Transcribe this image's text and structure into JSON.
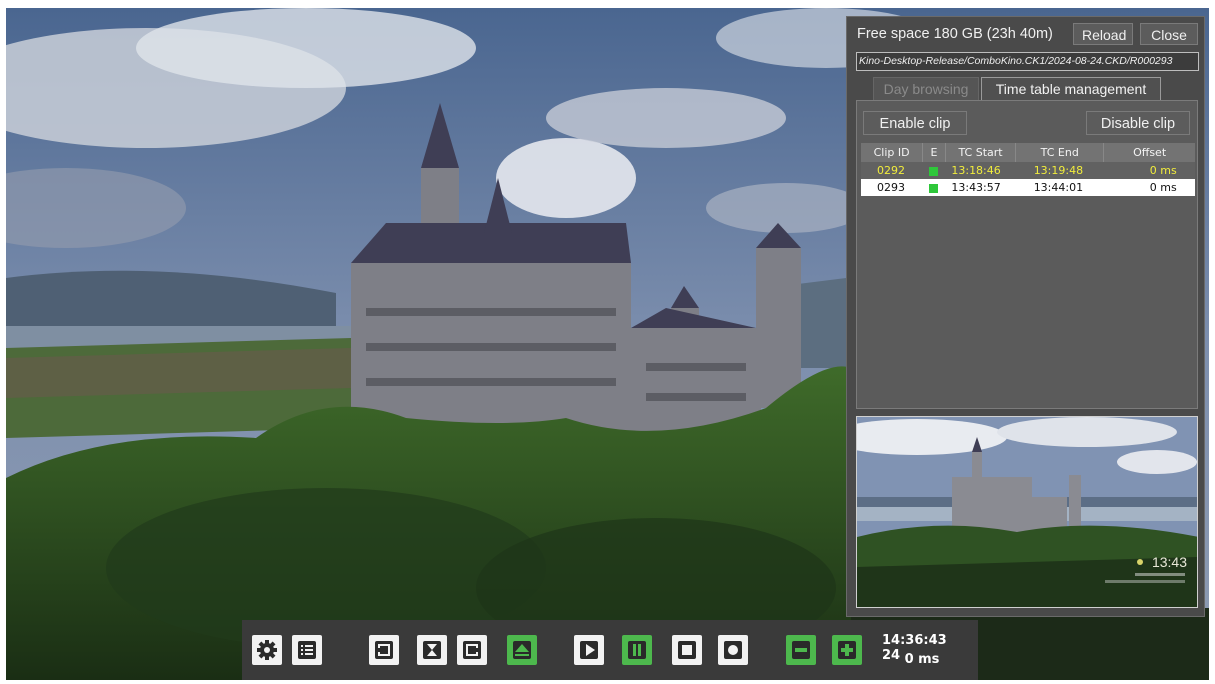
{
  "panel": {
    "free_space": "Free space 180 GB (23h 40m)",
    "reload_label": "Reload",
    "close_label": "Close",
    "path": "Kino-Desktop-Release/ComboKino.CK1/2024-08-24.CKD/R000293",
    "tabs": [
      {
        "label": "Day browsing",
        "active": false
      },
      {
        "label": "Time table management",
        "active": true
      }
    ],
    "enable_clip_label": "Enable clip",
    "disable_clip_label": "Disable clip",
    "table": {
      "headers": [
        "Clip ID",
        "E",
        "TC Start",
        "TC End",
        "Offset"
      ],
      "rows": [
        {
          "clip_id": "0292",
          "enabled": true,
          "tc_start": "13:18:46",
          "tc_end": "13:19:48",
          "offset": "0 ms",
          "selected": true
        },
        {
          "clip_id": "0293",
          "enabled": true,
          "tc_start": "13:43:57",
          "tc_end": "13:44:01",
          "offset": "0 ms",
          "selected": false
        }
      ]
    },
    "preview_time": "13:43"
  },
  "toolbar": {
    "buttons": [
      {
        "name": "settings",
        "icon": "gear-icon"
      },
      {
        "name": "list",
        "icon": "list-icon"
      },
      {
        "name": "mark-in",
        "icon": "bracket-in-icon"
      },
      {
        "name": "hourglass",
        "icon": "hourglass-icon"
      },
      {
        "name": "mark-out",
        "icon": "bracket-out-icon"
      },
      {
        "name": "eject",
        "icon": "eject-icon"
      },
      {
        "name": "play",
        "icon": "play-icon"
      },
      {
        "name": "pause",
        "icon": "pause-icon"
      },
      {
        "name": "stop",
        "icon": "stop-icon"
      },
      {
        "name": "record",
        "icon": "record-icon"
      },
      {
        "name": "minus",
        "icon": "minus-icon"
      },
      {
        "name": "plus",
        "icon": "plus-icon"
      }
    ],
    "timecode": "14:36:43 24",
    "offset": "0 ms"
  },
  "colors": {
    "accent_green": "#4db84d",
    "selected_row_text": "#f1ec3c",
    "panel_bg": "#4a4a4a"
  }
}
